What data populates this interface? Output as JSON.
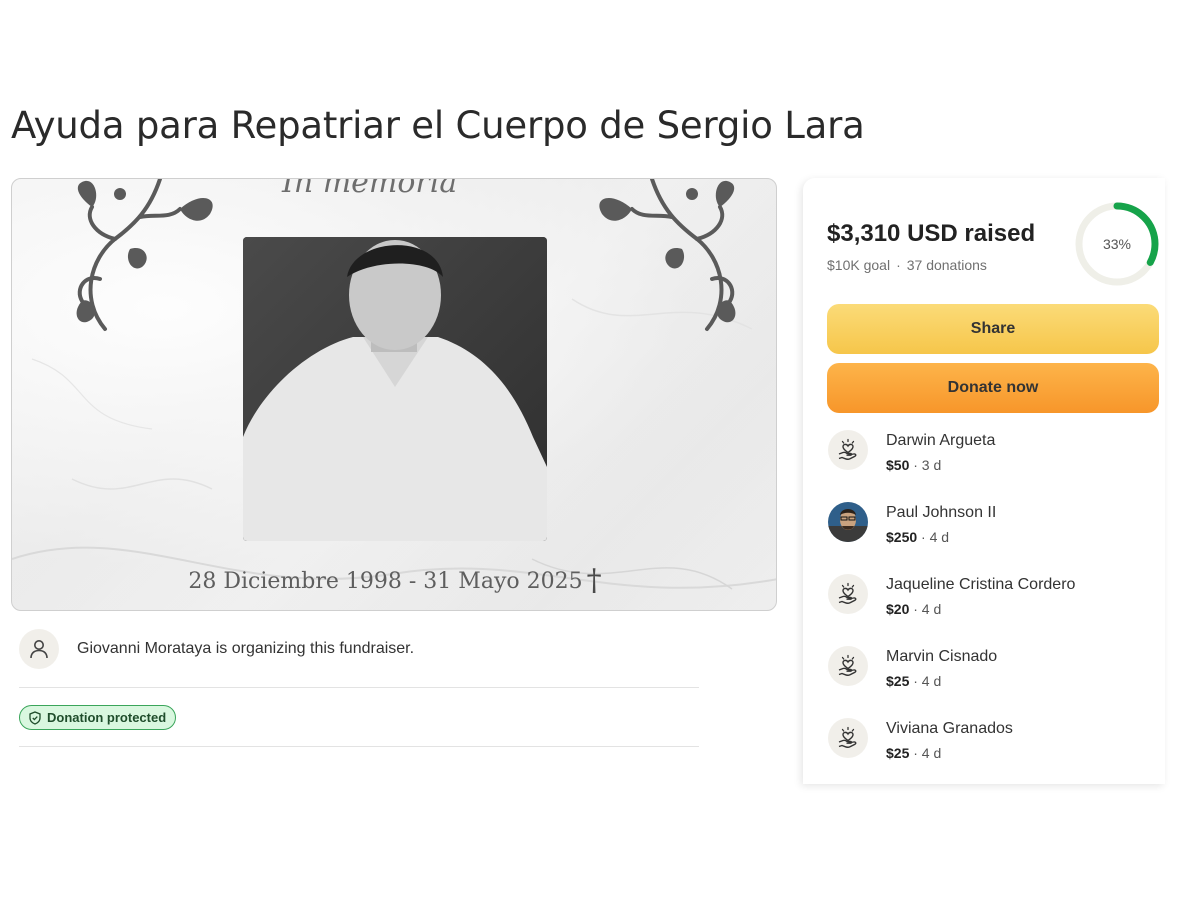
{
  "title": "Ayuda para Repatriar el Cuerpo de Sergio Lara",
  "hero": {
    "memoria_text": "In memoria",
    "dates": "28 Diciembre 1998 - 31 Mayo 2025",
    "cross": "†"
  },
  "organizer": {
    "text": "Giovanni Morataya is organizing this fundraiser."
  },
  "badge": {
    "label": "Donation protected"
  },
  "summary": {
    "raised": "$3,310 USD raised",
    "goal": "$10K goal",
    "separator": "·",
    "donations": "37 donations",
    "percent_label": "33%",
    "progress_fraction": 0.33
  },
  "buttons": {
    "share": "Share",
    "donate": "Donate now"
  },
  "donors": [
    {
      "name": "Darwin Argueta",
      "amount": "$50",
      "time": "· 3 d",
      "avatar": "heart-hand-icon"
    },
    {
      "name": "Paul Johnson II",
      "amount": "$250",
      "time": "· 4 d",
      "avatar": "user-photo"
    },
    {
      "name": "Jaqueline Cristina Cordero",
      "amount": "$20",
      "time": "· 4 d",
      "avatar": "heart-hand-icon"
    },
    {
      "name": "Marvin Cisnado",
      "amount": "$25",
      "time": "· 4 d",
      "avatar": "heart-hand-icon"
    },
    {
      "name": "Viviana Granados",
      "amount": "$25",
      "time": "· 4 d",
      "avatar": "heart-hand-icon"
    }
  ],
  "colors": {
    "share_button": "#f8cf5e",
    "donate_button": "#f9a53a",
    "progress": "#16a34a",
    "badge_bg": "#d9f7df"
  }
}
